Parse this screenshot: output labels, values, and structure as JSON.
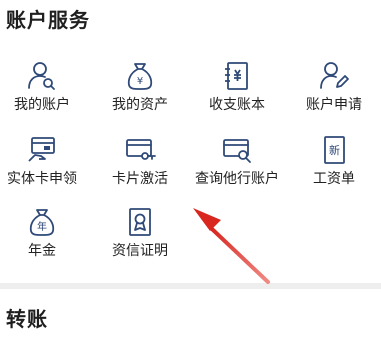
{
  "account_services": {
    "title": "账户服务",
    "items": [
      {
        "label": "我的账户",
        "icon": "user-search-icon"
      },
      {
        "label": "我的资产",
        "icon": "money-bag-icon"
      },
      {
        "label": "收支账本",
        "icon": "ledger-book-icon"
      },
      {
        "label": "账户申请",
        "icon": "user-edit-icon"
      },
      {
        "label": "实体卡申领",
        "icon": "card-hand-icon"
      },
      {
        "label": "卡片激活",
        "icon": "card-key-icon"
      },
      {
        "label": "查询他行账户",
        "icon": "card-search-icon"
      },
      {
        "label": "工资单",
        "icon": "payslip-icon"
      },
      {
        "label": "年金",
        "icon": "annuity-bag-icon"
      },
      {
        "label": "资信证明",
        "icon": "certificate-icon"
      }
    ]
  },
  "transfer": {
    "title": "转账"
  },
  "icon_glyphs": {
    "money_bag": "¥",
    "payslip": "新",
    "annuity": "年"
  },
  "colors": {
    "icon_stroke": "#2f4a78",
    "arrow": "#e0302a"
  }
}
